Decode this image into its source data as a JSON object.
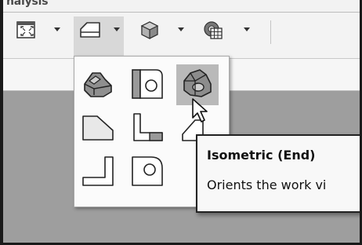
{
  "window": {
    "ribbon_tab_label": "nalysis"
  },
  "toolbar": {
    "buttons": [
      {
        "name": "zoom-all-button",
        "icon": "zoom-all-icon",
        "has_dropdown": true
      },
      {
        "name": "view-orientation-button",
        "icon": "view-plane-icon",
        "has_dropdown": true,
        "active": true
      },
      {
        "name": "visual-style-button",
        "icon": "shaded-cube-icon",
        "has_dropdown": true
      },
      {
        "name": "display-settings-button",
        "icon": "gear-grid-icon",
        "has_dropdown": true
      }
    ]
  },
  "view_menu": {
    "items": [
      {
        "name": "isometric-front-view",
        "icon": "isometric-front-icon",
        "hovered": false
      },
      {
        "name": "front-face-view",
        "icon": "front-face-icon",
        "hovered": false
      },
      {
        "name": "isometric-end-view",
        "icon": "isometric-end-icon",
        "hovered": true
      },
      {
        "name": "top-view",
        "icon": "top-view-icon",
        "hovered": false
      },
      {
        "name": "side-view",
        "icon": "side-view-icon",
        "hovered": false
      },
      {
        "name": "angled-view",
        "icon": "angled-view-icon",
        "hovered": false
      },
      {
        "name": "bottom-view",
        "icon": "bottom-view-icon",
        "hovered": false
      },
      {
        "name": "end-face-view",
        "icon": "end-face-icon",
        "hovered": false
      }
    ]
  },
  "tooltip": {
    "title": "Isometric (End)",
    "description": "Orients the work vi"
  },
  "colors": {
    "toolbar_bg": "#f3f3f3",
    "canvas_bg": "#9e9e9e",
    "hover_bg": "#b9b9b9",
    "active_bg": "#d8d8d8"
  }
}
